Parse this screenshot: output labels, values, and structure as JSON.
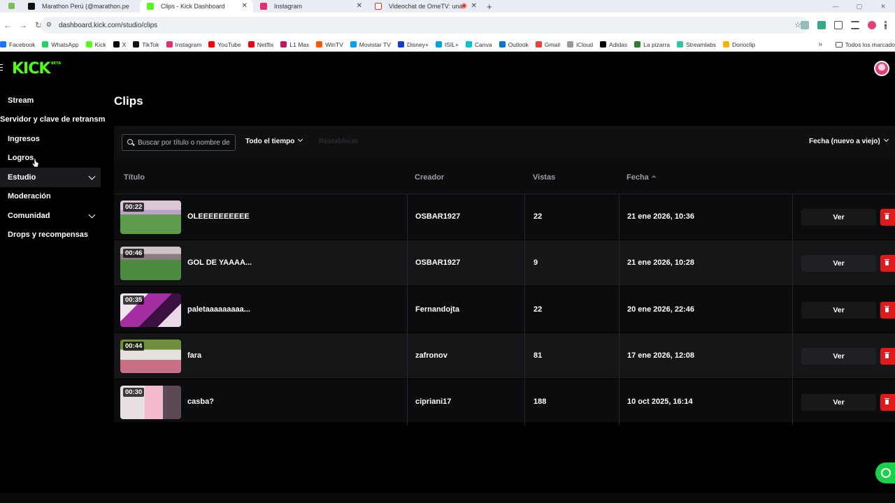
{
  "browser": {
    "tabs": [
      {
        "title": "Marathon Perú (@marathon.pe",
        "favicon_color": "#111111",
        "active": false
      },
      {
        "title": "Clips - Kick Dashboard",
        "favicon_color": "#53fc18",
        "active": true
      },
      {
        "title": "Instagram",
        "favicon_color": "#e1306c",
        "active": false
      },
      {
        "title": "Videochat de OmeTV: una",
        "favicon_color": "#d93025",
        "active": false
      }
    ],
    "url": "dashboard.kick.com/studio/clips",
    "bookmarks": [
      {
        "label": "Facebook",
        "color": "#1877f2"
      },
      {
        "label": "WhatsApp",
        "color": "#25d366"
      },
      {
        "label": "Kick",
        "color": "#53fc18"
      },
      {
        "label": "X",
        "color": "#000000"
      },
      {
        "label": "TikTok",
        "color": "#111111"
      },
      {
        "label": "Instagram",
        "color": "#e1306c"
      },
      {
        "label": "YouTube",
        "color": "#ff0000"
      },
      {
        "label": "Netflix",
        "color": "#e50914"
      },
      {
        "label": "L1 Max",
        "color": "#c2185b"
      },
      {
        "label": "WinTV",
        "color": "#ff5a00"
      },
      {
        "label": "Movistar TV",
        "color": "#019df4"
      },
      {
        "label": "Disney+",
        "color": "#113ccf"
      },
      {
        "label": "ISIL+",
        "color": "#00a3e0"
      },
      {
        "label": "Canva",
        "color": "#00c4cc"
      },
      {
        "label": "Outlook",
        "color": "#0078d4"
      },
      {
        "label": "Gmail",
        "color": "#ea4335"
      },
      {
        "label": "iCloud",
        "color": "#999999"
      },
      {
        "label": "Adidas",
        "color": "#000000"
      },
      {
        "label": "La pizarra",
        "color": "#2e7d32"
      },
      {
        "label": "Streamlabs",
        "color": "#31c3a2"
      },
      {
        "label": "Donoclip",
        "color": "#f4b400"
      }
    ],
    "bookmarks_folder": "Todos los marcado"
  },
  "app": {
    "logo": "KICK",
    "logo_badge": "BETA",
    "sidebar": [
      {
        "label": "Stream",
        "chevron": false
      },
      {
        "label": "Servidor y clave de retransm",
        "chevron": false
      },
      {
        "label": "Ingresos",
        "chevron": false
      },
      {
        "label": "Logros",
        "chevron": false
      },
      {
        "label": "Estudio",
        "chevron": true
      },
      {
        "label": "Moderación",
        "chevron": false
      },
      {
        "label": "Comunidad",
        "chevron": true
      },
      {
        "label": "Drops y recompensas",
        "chevron": false
      }
    ],
    "page_title": "Clips",
    "filters": {
      "search_placeholder": "Buscar por título o nombre de",
      "time_filter": "Todo el tiempo",
      "reset_label": "Restablecer",
      "sort_label": "Fecha (nuevo a viejo)"
    },
    "columns": {
      "title": "Título",
      "creator": "Creador",
      "views": "Vistas",
      "date": "Fecha"
    },
    "clips": [
      {
        "duration": "00:22",
        "title": "OLEEEEEEEEEE",
        "creator": "OSBAR1927",
        "views": "22",
        "date": "21 ene 2026, 10:36",
        "action": "Ver"
      },
      {
        "duration": "00:46",
        "title": "GOL DE YAAAA...",
        "creator": "OSBAR1927",
        "views": "9",
        "date": "21 ene 2026, 10:28",
        "action": "Ver"
      },
      {
        "duration": "00:35",
        "title": "paletaaaaaaaaa...",
        "creator": "Fernandojta",
        "views": "22",
        "date": "20 ene 2026, 22:46",
        "action": "Ver"
      },
      {
        "duration": "00:44",
        "title": "fara",
        "creator": "zafronov",
        "views": "81",
        "date": "17 ene 2026, 12:08",
        "action": "Ver"
      },
      {
        "duration": "00:30",
        "title": "casba?",
        "creator": "cipriani17",
        "views": "188",
        "date": "10 oct 2025, 16:14",
        "action": "Ver"
      }
    ],
    "colors": {
      "brand": "#53fc18",
      "delete": "#e01a1a",
      "help": "#1bd14b"
    }
  }
}
